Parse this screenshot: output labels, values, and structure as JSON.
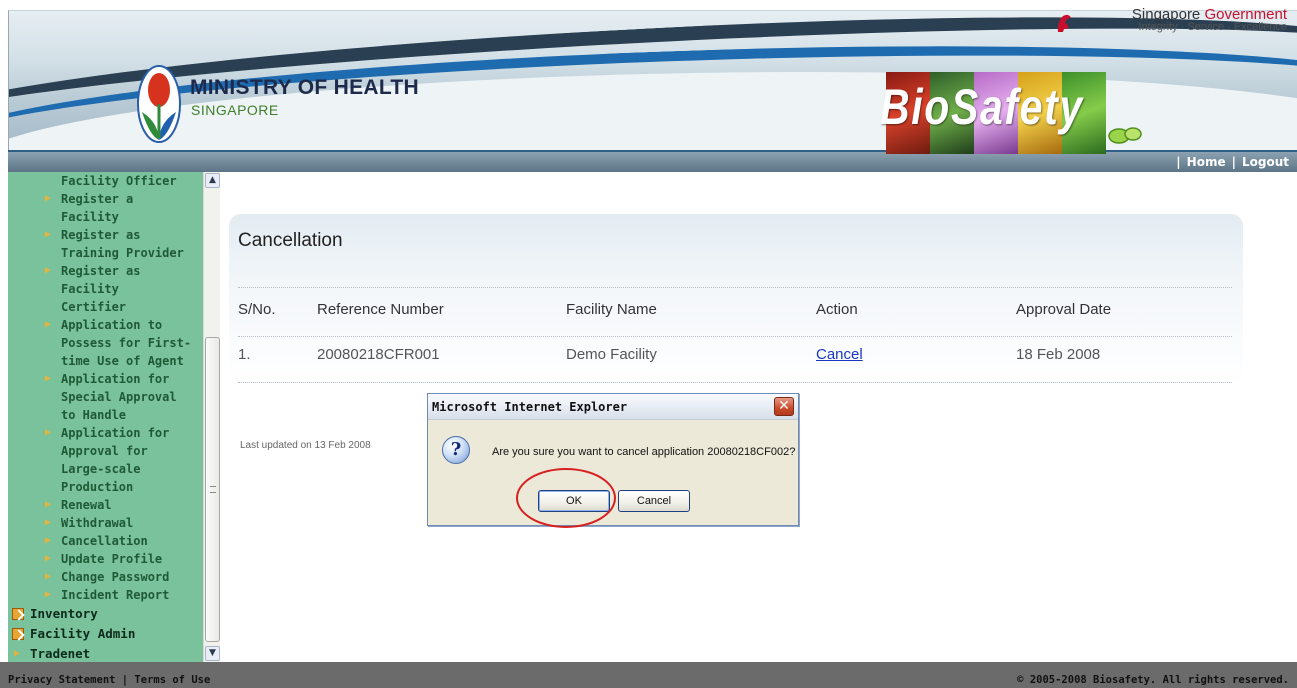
{
  "header": {
    "ministry_title": "MINISTRY OF HEALTH",
    "ministry_subtitle": "SINGAPORE",
    "gov_name_part1": "Singapore",
    "gov_name_part2": "Government",
    "gov_tagline": "Integrity · Service · Excellence",
    "brand_logo_text": "BioSafety",
    "links": {
      "home": "Home",
      "logout": "Logout",
      "separator": "|"
    }
  },
  "sidebar": {
    "items": [
      {
        "label": "Facility Officer",
        "bullet": false
      },
      {
        "label": "Register a Facility",
        "bullet": true
      },
      {
        "label": "Register as",
        "bullet": true
      },
      {
        "label": "Training Provider",
        "bullet": false
      },
      {
        "label": "Register as Facility",
        "bullet": true
      },
      {
        "label": "Certifier",
        "bullet": false
      },
      {
        "label": "Application to",
        "bullet": true
      },
      {
        "label": "Possess for First-",
        "bullet": false
      },
      {
        "label": "time Use of Agent",
        "bullet": false
      },
      {
        "label": "Application for",
        "bullet": true
      },
      {
        "label": "Special Approval",
        "bullet": false
      },
      {
        "label": "to Handle",
        "bullet": false
      },
      {
        "label": "Application for",
        "bullet": true
      },
      {
        "label": "Approval for",
        "bullet": false
      },
      {
        "label": "Large-scale",
        "bullet": false
      },
      {
        "label": "Production",
        "bullet": false
      },
      {
        "label": "Renewal",
        "bullet": true
      },
      {
        "label": "Withdrawal",
        "bullet": true
      },
      {
        "label": "Cancellation",
        "bullet": true
      },
      {
        "label": "Update Profile",
        "bullet": true
      },
      {
        "label": "Change Password",
        "bullet": true
      },
      {
        "label": "Incident Report",
        "bullet": true
      }
    ],
    "top_items": {
      "inventory": "Inventory",
      "facility_admin": "Facility Admin",
      "tradenet": "Tradenet"
    }
  },
  "main": {
    "title": "Cancellation",
    "columns": {
      "sno": "S/No.",
      "ref": "Reference Number",
      "facility": "Facility Name",
      "action": "Action",
      "date": "Approval Date"
    },
    "rows": [
      {
        "sno": "1.",
        "ref": "20080218CFR001",
        "facility": "Demo Facility",
        "action": "Cancel",
        "date": "18 Feb 2008"
      }
    ],
    "last_updated": "Last updated on 13 Feb 2008"
  },
  "dialog": {
    "title": "Microsoft Internet Explorer",
    "close_glyph": "✕",
    "icon_glyph": "?",
    "message": "Are you sure you want to cancel application 20080218CF002?",
    "ok_label": "OK",
    "cancel_label": "Cancel"
  },
  "footer": {
    "left": "Privacy Statement | Terms of Use",
    "right": "© 2005-2008 Biosafety. All rights reserved."
  },
  "colors": {
    "sidebar_bg": "#79c29c",
    "link": "#1a36c0",
    "highlight_circle": "#d62020",
    "footer_bg": "#6b6b6b"
  }
}
